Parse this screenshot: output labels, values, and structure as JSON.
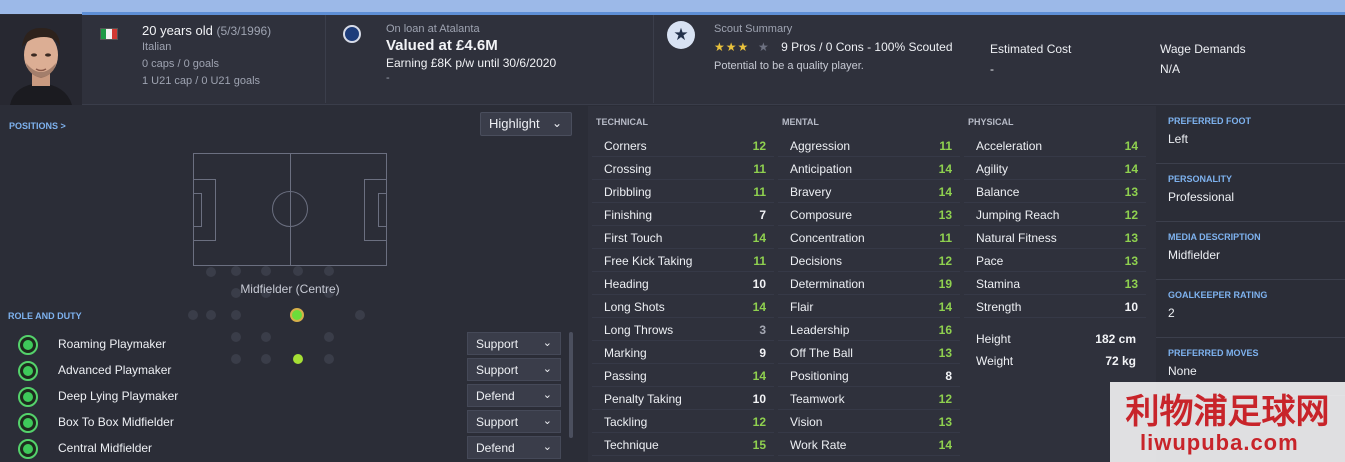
{
  "header": {
    "age": "20 years old",
    "dob": "(5/3/1996)",
    "nationality": "Italian",
    "caps": "0 caps / 0 goals",
    "u21": "1 U21 cap / 0 U21 goals",
    "loan": "On loan at Atalanta",
    "value": "Valued at £4.6M",
    "earning": "Earning £8K p/w until 30/6/2020",
    "dash": "-",
    "scout_title": "Scout Summary",
    "scout_stars_filled": "★★★",
    "scout_stars_empty": "★",
    "scout_line": "9 Pros / 0 Cons - 100% Scouted",
    "scout_note": "Potential to be a quality player.",
    "est_cost_label": "Estimated Cost",
    "est_cost_value": "-",
    "wage_label": "Wage Demands",
    "wage_value": "N/A",
    "colors": {
      "flag_green": "#1e9a46",
      "flag_white": "#f3f3f3",
      "flag_red": "#d23a33"
    }
  },
  "positions": {
    "link": "POSITIONS >",
    "highlight": "Highlight",
    "label": "Midfielder (Centre)"
  },
  "roles": {
    "title": "ROLE AND DUTY",
    "items": [
      {
        "name": "Roaming Playmaker",
        "duty": "Support"
      },
      {
        "name": "Advanced Playmaker",
        "duty": "Support"
      },
      {
        "name": "Deep Lying Playmaker",
        "duty": "Defend"
      },
      {
        "name": "Box To Box Midfielder",
        "duty": "Support"
      },
      {
        "name": "Central Midfielder",
        "duty": "Defend"
      }
    ]
  },
  "attributes": {
    "technical": {
      "title": "TECHNICAL",
      "items": [
        {
          "name": "Corners",
          "value": "12"
        },
        {
          "name": "Crossing",
          "value": "11"
        },
        {
          "name": "Dribbling",
          "value": "11"
        },
        {
          "name": "Finishing",
          "value": "7"
        },
        {
          "name": "First Touch",
          "value": "14"
        },
        {
          "name": "Free Kick Taking",
          "value": "11"
        },
        {
          "name": "Heading",
          "value": "10"
        },
        {
          "name": "Long Shots",
          "value": "14"
        },
        {
          "name": "Long Throws",
          "value": "3"
        },
        {
          "name": "Marking",
          "value": "9"
        },
        {
          "name": "Passing",
          "value": "14"
        },
        {
          "name": "Penalty Taking",
          "value": "10"
        },
        {
          "name": "Tackling",
          "value": "12"
        },
        {
          "name": "Technique",
          "value": "15"
        }
      ]
    },
    "mental": {
      "title": "MENTAL",
      "items": [
        {
          "name": "Aggression",
          "value": "11"
        },
        {
          "name": "Anticipation",
          "value": "14"
        },
        {
          "name": "Bravery",
          "value": "14"
        },
        {
          "name": "Composure",
          "value": "13"
        },
        {
          "name": "Concentration",
          "value": "11"
        },
        {
          "name": "Decisions",
          "value": "12"
        },
        {
          "name": "Determination",
          "value": "19"
        },
        {
          "name": "Flair",
          "value": "14"
        },
        {
          "name": "Leadership",
          "value": "16"
        },
        {
          "name": "Off The Ball",
          "value": "13"
        },
        {
          "name": "Positioning",
          "value": "8"
        },
        {
          "name": "Teamwork",
          "value": "12"
        },
        {
          "name": "Vision",
          "value": "13"
        },
        {
          "name": "Work Rate",
          "value": "14"
        }
      ]
    },
    "physical": {
      "title": "PHYSICAL",
      "items": [
        {
          "name": "Acceleration",
          "value": "14"
        },
        {
          "name": "Agility",
          "value": "14"
        },
        {
          "name": "Balance",
          "value": "13"
        },
        {
          "name": "Jumping Reach",
          "value": "12"
        },
        {
          "name": "Natural Fitness",
          "value": "13"
        },
        {
          "name": "Pace",
          "value": "13"
        },
        {
          "name": "Stamina",
          "value": "13"
        },
        {
          "name": "Strength",
          "value": "10"
        }
      ],
      "height_label": "Height",
      "height_value": "182 cm",
      "weight_label": "Weight",
      "weight_value": "72 kg"
    },
    "colors": {
      "high": "#8fd14f",
      "mid": "#f2f3f6",
      "low": "#a5a8b3"
    }
  },
  "info": [
    {
      "label": "PREFERRED FOOT",
      "value": "Left"
    },
    {
      "label": "PERSONALITY",
      "value": "Professional"
    },
    {
      "label": "MEDIA DESCRIPTION",
      "value": "Midfielder"
    },
    {
      "label": "GOALKEEPER RATING",
      "value": "2"
    },
    {
      "label": "PREFERRED MOVES",
      "value": "None"
    }
  ],
  "watermark": {
    "big": "利物浦足球网",
    "small": "liwupuba.com"
  }
}
